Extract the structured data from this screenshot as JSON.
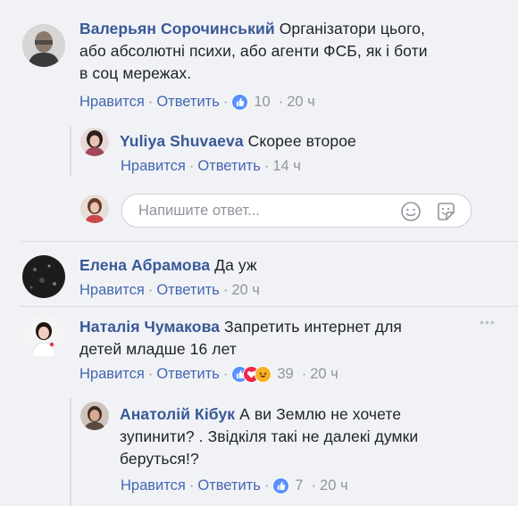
{
  "comments": [
    {
      "author": "Валерьян Сорочинський",
      "lines": [
        "Організатори цього,",
        "або абсолютні психи, або агенти ФСБ, як і боти",
        "в соц мережах."
      ],
      "like_label": "Нравится",
      "reply_label": "Ответить",
      "reactions_count": "10",
      "time": "20 ч",
      "reactions": [
        "like"
      ]
    },
    {
      "author": "Yuliya Shuvaeva",
      "lines": [
        "Скорее второе"
      ],
      "like_label": "Нравится",
      "reply_label": "Ответить",
      "time": "14 ч"
    },
    {
      "author": "Елена Абрамова",
      "lines": [
        "Да уж"
      ],
      "like_label": "Нравится",
      "reply_label": "Ответить",
      "time": "20 ч"
    },
    {
      "author": "Наталія Чумакова",
      "lines": [
        "Запретить интернет для",
        "детей младше 16 лет"
      ],
      "like_label": "Нравится",
      "reply_label": "Ответить",
      "reactions_count": "39",
      "time": "20 ч",
      "reactions": [
        "like",
        "love",
        "haha"
      ]
    },
    {
      "author": "Анатолій Кібук",
      "lines": [
        "А ви Землю не хочете",
        "зупинити? . Звідкіля такі не далекі думки",
        "беруться!?"
      ],
      "like_label": "Нравится",
      "reply_label": "Ответить",
      "reactions_count": "7",
      "time": "20 ч",
      "reactions": [
        "like"
      ]
    }
  ],
  "reply_input": {
    "placeholder": "Напишите ответ..."
  },
  "colors": {
    "link": "#4267b2",
    "name": "#385898",
    "meta": "#90949c",
    "like": "#5890ff",
    "love": "#f0284a",
    "haha": "#f7b125"
  }
}
